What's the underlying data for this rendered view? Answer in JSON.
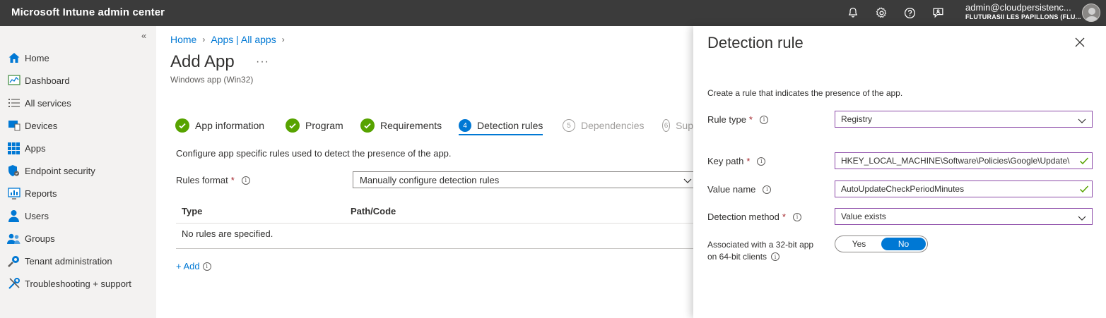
{
  "topbar": {
    "title": "Microsoft Intune admin center",
    "user_email": "admin@cloudpersistenc...",
    "user_tenant": "FLUTURASII LES PAPILLONS (FLU..."
  },
  "sidebar": {
    "items": [
      {
        "label": "Home",
        "icon": "home-icon"
      },
      {
        "label": "Dashboard",
        "icon": "dashboard-icon"
      },
      {
        "label": "All services",
        "icon": "list-icon"
      },
      {
        "label": "Devices",
        "icon": "devices-icon"
      },
      {
        "label": "Apps",
        "icon": "apps-grid-icon"
      },
      {
        "label": "Endpoint security",
        "icon": "shield-icon"
      },
      {
        "label": "Reports",
        "icon": "reports-icon"
      },
      {
        "label": "Users",
        "icon": "user-icon"
      },
      {
        "label": "Groups",
        "icon": "groups-icon"
      },
      {
        "label": "Tenant administration",
        "icon": "gear-icon"
      },
      {
        "label": "Troubleshooting + support",
        "icon": "tools-icon"
      }
    ]
  },
  "main": {
    "breadcrumb": [
      "Home",
      "Apps | All apps"
    ],
    "title": "Add App",
    "subtitle": "Windows app (Win32)",
    "steps": [
      {
        "label": "App information",
        "state": "done"
      },
      {
        "label": "Program",
        "state": "done"
      },
      {
        "label": "Requirements",
        "state": "done"
      },
      {
        "num": "4",
        "label": "Detection rules",
        "state": "active"
      },
      {
        "num": "5",
        "label": "Dependencies",
        "state": "pending"
      },
      {
        "num": "6",
        "label": "Sup",
        "state": "pending"
      }
    ],
    "description": "Configure app specific rules used to detect the presence of the app.",
    "rules_format_label": "Rules format",
    "rules_format_value": "Manually configure detection rules",
    "table": {
      "col_type": "Type",
      "col_path": "Path/Code",
      "empty": "No rules are specified."
    },
    "add_label": "+ Add"
  },
  "panel": {
    "title": "Detection rule",
    "description": "Create a rule that indicates the presence of the app.",
    "rule_type_label": "Rule type",
    "rule_type_value": "Registry",
    "key_path_label": "Key path",
    "key_path_value": "HKEY_LOCAL_MACHINE\\Software\\Policies\\Google\\Update\\",
    "value_name_label": "Value name",
    "value_name_value": "AutoUpdateCheckPeriodMinutes",
    "detection_method_label": "Detection method",
    "detection_method_value": "Value exists",
    "assoc_label_1": "Associated with a 32-bit app",
    "assoc_label_2": "on 64-bit clients",
    "toggle_yes": "Yes",
    "toggle_no": "No",
    "toggle_selected": "No"
  },
  "colors": {
    "topbar": "#3b3b3b",
    "accent": "#0078d4",
    "success": "#57a300",
    "required": "#a4262c"
  }
}
